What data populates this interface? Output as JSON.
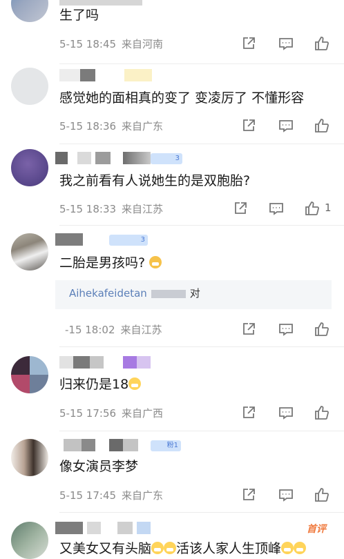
{
  "comments": [
    {
      "text": "生了吗",
      "date": "5-15 18:45",
      "location": "来自河南",
      "like_count": ""
    },
    {
      "text": "感觉她的面相真的变了 变凌厉了 不懂形容",
      "date": "5-15 18:36",
      "location": "来自广东",
      "like_count": ""
    },
    {
      "text": "我之前看有人说她生的是双胞胎?",
      "date": "5-15 18:33",
      "location": "来自江苏",
      "like_count": "1",
      "badge": "3"
    },
    {
      "text": "二胎是男孩吗?",
      "reply": "Aihekafeidetan",
      "reply_suffix": "对",
      "date": "-15 18:02",
      "location": "来自江苏",
      "like_count": "",
      "badge": "3"
    },
    {
      "text": "归来仍是18",
      "date": "5-15 17:56",
      "location": "来自广西",
      "like_count": ""
    },
    {
      "text": "像女演员李梦",
      "date": "5-15 17:45",
      "location": "来自广东",
      "like_count": "",
      "badge": "粉1"
    },
    {
      "text_a": "又美女又有头脑",
      "text_b": "活该人家人生顶峰",
      "hot_label": "首评"
    }
  ],
  "icons": {
    "share": "share-icon",
    "comment": "comment-icon",
    "like": "thumbs-up-icon"
  },
  "colors": {
    "meta_text": "#8a8a8a",
    "badge_bg": "#cfe2fb",
    "hot_tag": "#f07a3e"
  }
}
